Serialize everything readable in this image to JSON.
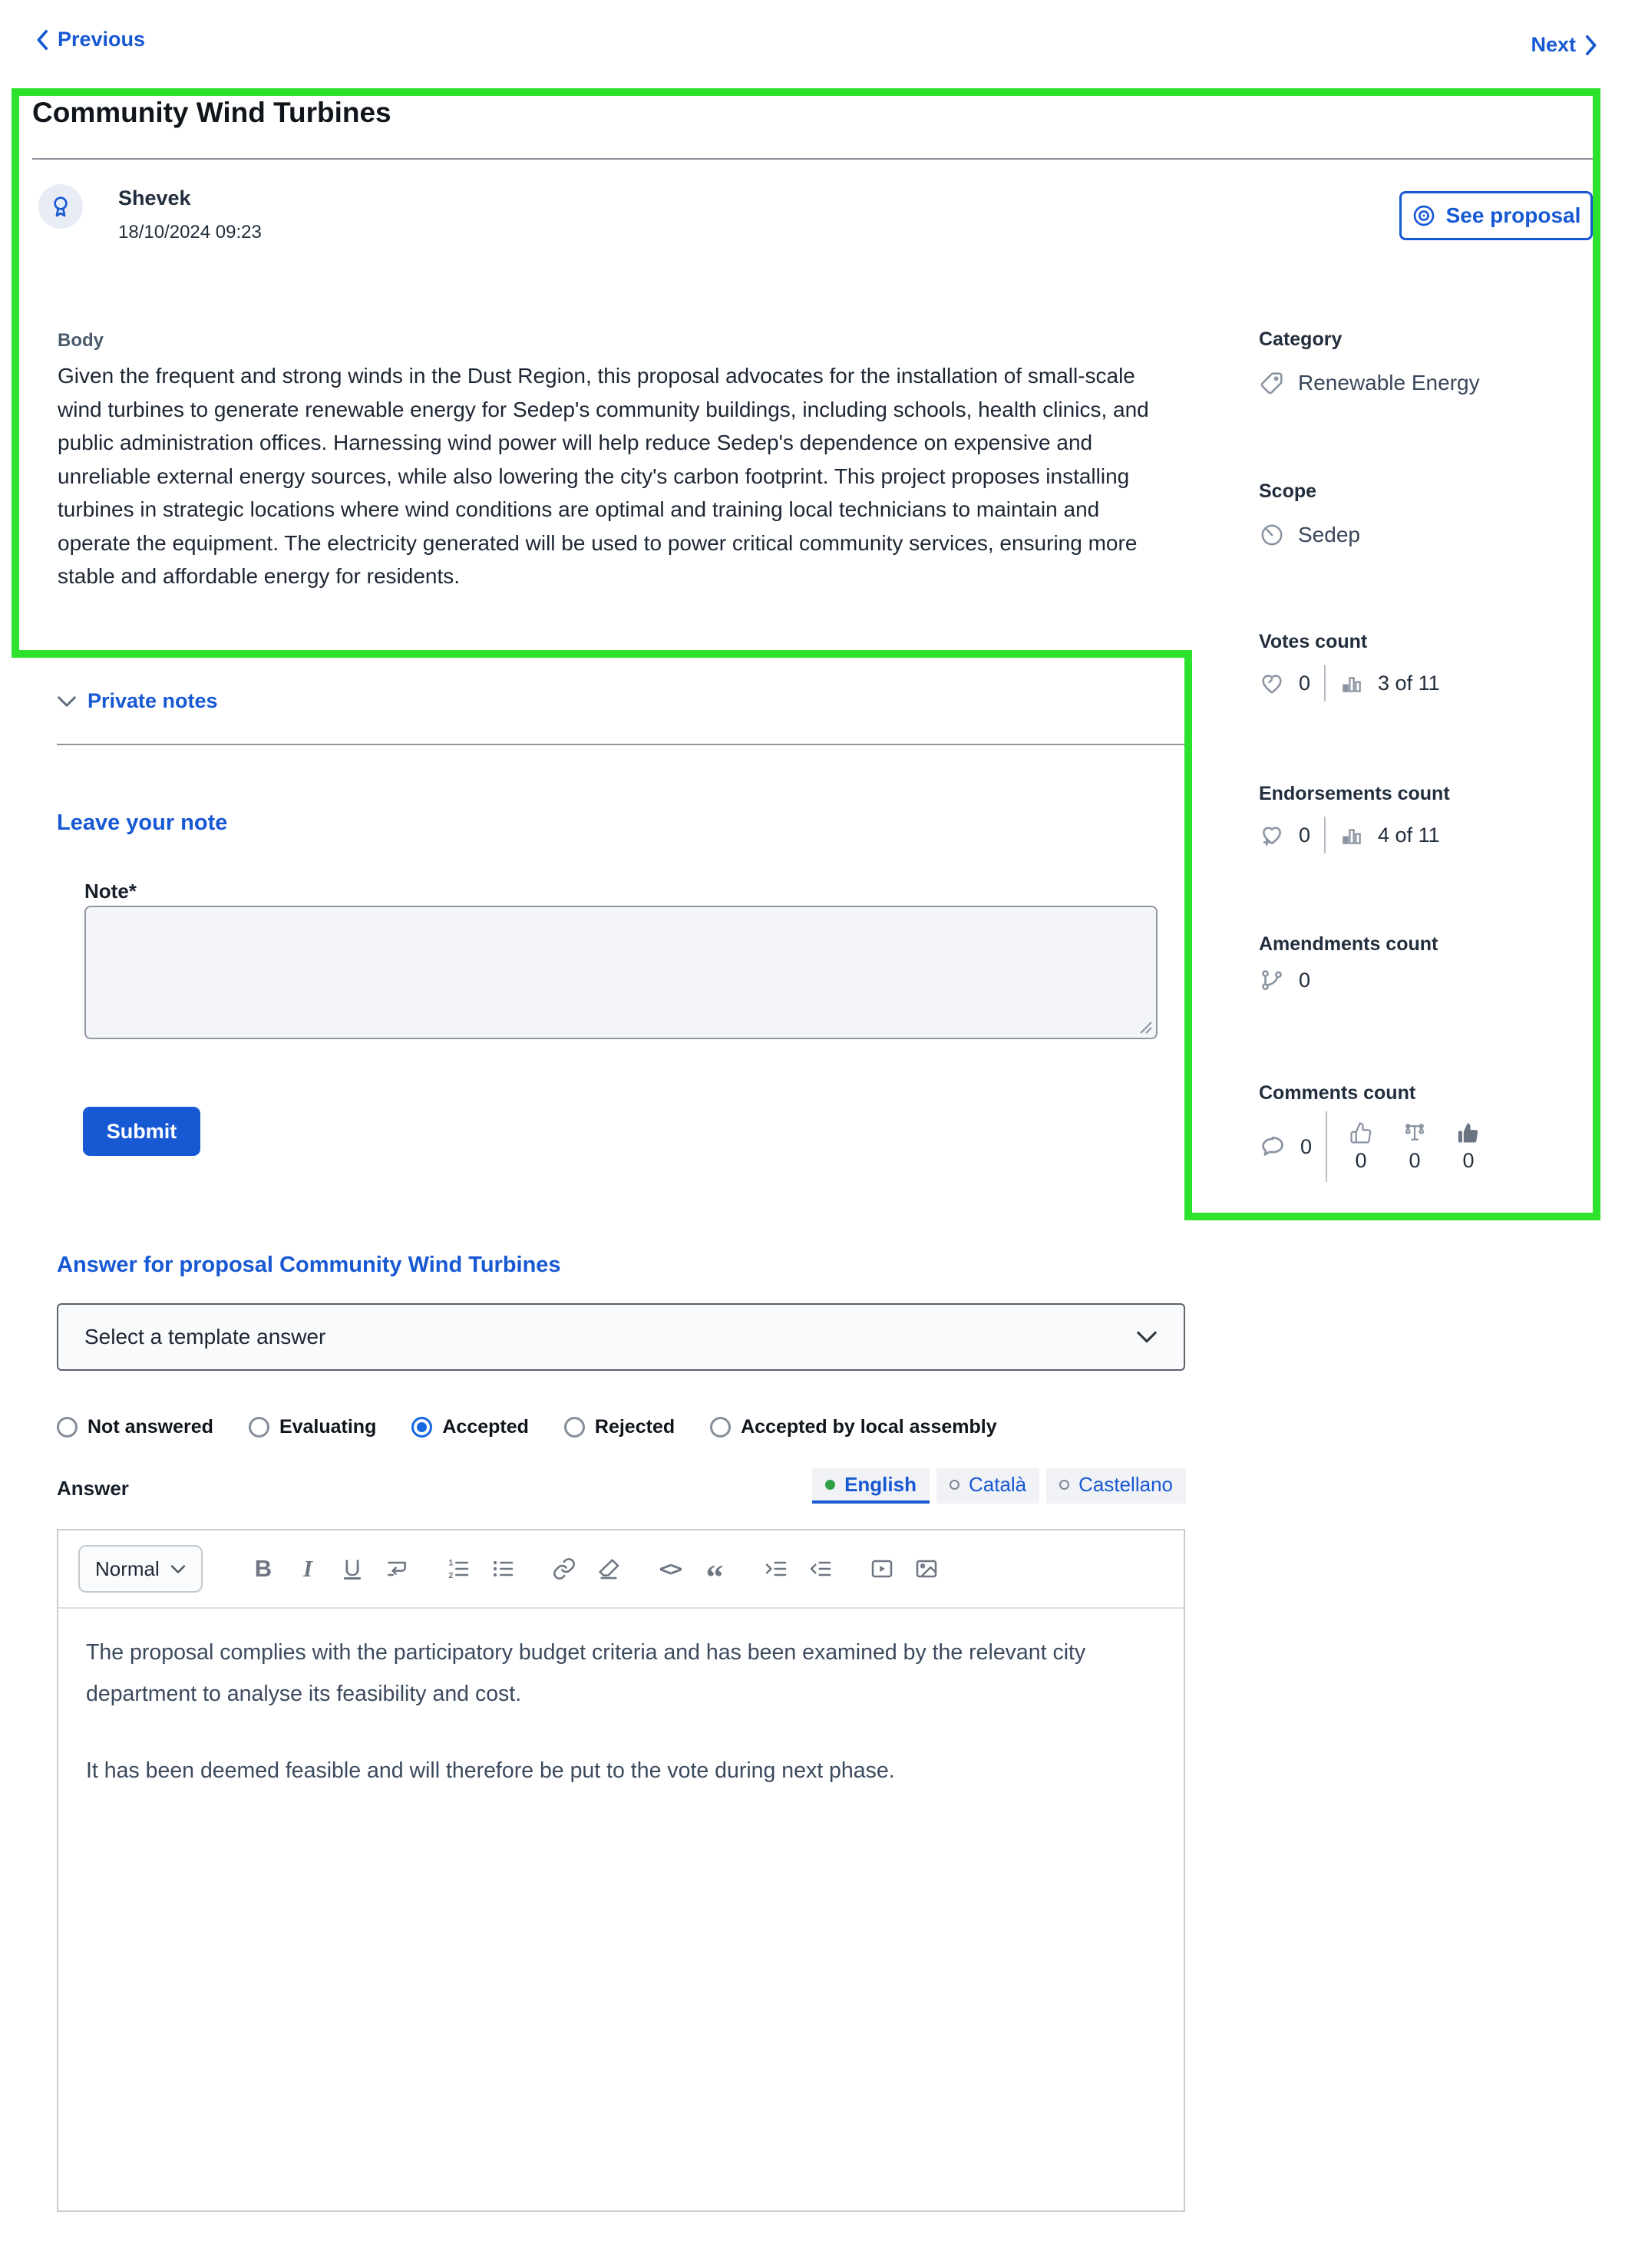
{
  "colors": {
    "accent_blue": "#1758d3",
    "highlight_green": "#2ce22c",
    "icon_gray": "#8a93a2",
    "lang_dot_green": "#2f9e44"
  },
  "nav": {
    "previous_label": "Previous",
    "next_label": "Next"
  },
  "proposal": {
    "title": "Community Wind Turbines",
    "author": "Shevek",
    "date": "18/10/2024 09:23",
    "see_proposal_label": "See proposal",
    "body_label": "Body",
    "body": "Given the frequent and strong winds in the Dust Region, this proposal advocates for the installation of small-scale wind turbines to generate renewable energy for Sedep's community buildings, including schools, health clinics, and public administration offices. Harnessing wind power will help reduce Sedep's dependence on expensive and unreliable external energy sources, while also lowering the city's carbon footprint. This project proposes installing turbines in strategic locations where wind conditions are optimal and training local technicians to maintain and operate the equipment. The electricity generated will be used to power critical community services, ensuring more stable and affordable energy for residents."
  },
  "sidebar": {
    "category_label": "Category",
    "category_value": "Renewable Energy",
    "scope_label": "Scope",
    "scope_value": "Sedep",
    "votes_label": "Votes count",
    "votes_count": "0",
    "votes_rank": "3 of 11",
    "endorsements_label": "Endorsements count",
    "endorsements_count": "0",
    "endorsements_rank": "4 of 11",
    "amendments_label": "Amendments count",
    "amendments_count": "0",
    "comments_label": "Comments count",
    "comments_count": "0",
    "comments_in_favor": "0",
    "comments_neutral": "0",
    "comments_against": "0"
  },
  "notes": {
    "section_title": "Private notes",
    "heading": "Leave your note",
    "note_label": "Note*",
    "note_value": "",
    "submit_label": "Submit"
  },
  "answer": {
    "heading": "Answer for proposal Community Wind Turbines",
    "template_placeholder": "Select a template answer",
    "selected_status": "Accepted",
    "statuses": [
      {
        "label": "Not answered",
        "selected": false
      },
      {
        "label": "Evaluating",
        "selected": false
      },
      {
        "label": "Accepted",
        "selected": true
      },
      {
        "label": "Rejected",
        "selected": false
      },
      {
        "label": "Accepted by local assembly",
        "selected": false
      }
    ],
    "answer_label": "Answer",
    "selected_language": "English",
    "languages": [
      {
        "label": "English",
        "selected": true
      },
      {
        "label": "Català",
        "selected": false
      },
      {
        "label": "Castellano",
        "selected": false
      }
    ],
    "editor": {
      "format_label": "Normal",
      "toolbar": [
        "bold",
        "italic",
        "underline",
        "line-break",
        "ordered-list",
        "bullet-list",
        "link",
        "clear-format",
        "code",
        "quote",
        "indent",
        "outdent",
        "video",
        "image"
      ],
      "paragraphs": [
        "The proposal complies with the participatory budget criteria and has been examined by the relevant city department to analyse its feasibility and cost.",
        "It has been deemed feasible and will therefore be put to the vote during next phase."
      ]
    }
  }
}
